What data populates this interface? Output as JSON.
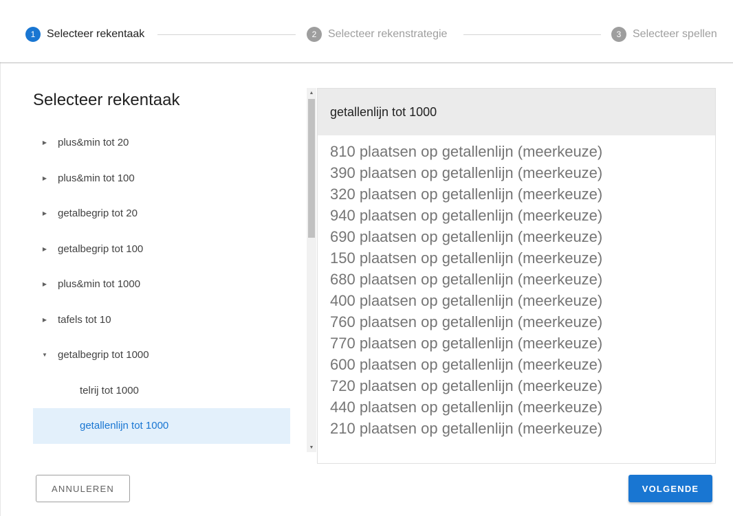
{
  "stepper": {
    "steps": [
      {
        "number": "1",
        "label": "Selecteer rekentaak"
      },
      {
        "number": "2",
        "label": "Selecteer rekenstrategie"
      },
      {
        "number": "3",
        "label": "Selecteer spellen"
      }
    ]
  },
  "left_panel": {
    "title": "Selecteer rekentaak",
    "tree": [
      {
        "label": "plus&min tot 20"
      },
      {
        "label": "plus&min tot 100"
      },
      {
        "label": "getalbegrip tot 20"
      },
      {
        "label": "getalbegrip tot 100"
      },
      {
        "label": "plus&min tot 1000"
      },
      {
        "label": "tafels tot 10"
      },
      {
        "label": "getalbegrip tot 1000"
      },
      {
        "label": "telrij tot 1000"
      },
      {
        "label": "getallenlijn tot 1000"
      }
    ]
  },
  "right_panel": {
    "header": "getallenlijn tot 1000",
    "items": [
      "810 plaatsen op getallenlijn (meerkeuze)",
      "390 plaatsen op getallenlijn (meerkeuze)",
      "320 plaatsen op getallenlijn (meerkeuze)",
      "940 plaatsen op getallenlijn (meerkeuze)",
      "690 plaatsen op getallenlijn (meerkeuze)",
      "150 plaatsen op getallenlijn (meerkeuze)",
      "680 plaatsen op getallenlijn (meerkeuze)",
      "400 plaatsen op getallenlijn (meerkeuze)",
      "760 plaatsen op getallenlijn (meerkeuze)",
      "770 plaatsen op getallenlijn (meerkeuze)",
      "600 plaatsen op getallenlijn (meerkeuze)",
      "720 plaatsen op getallenlijn (meerkeuze)",
      "440 plaatsen op getallenlijn (meerkeuze)",
      "210 plaatsen op getallenlijn (meerkeuze)"
    ]
  },
  "buttons": {
    "cancel": "ANNULEREN",
    "next": "VOLGENDE"
  },
  "icons": {
    "collapsed": "caret-right-icon",
    "expanded": "caret-down-icon"
  },
  "colors": {
    "primary": "#1976d2",
    "selected_bg": "#e3f0fb",
    "inactive_step": "#9e9e9e"
  }
}
